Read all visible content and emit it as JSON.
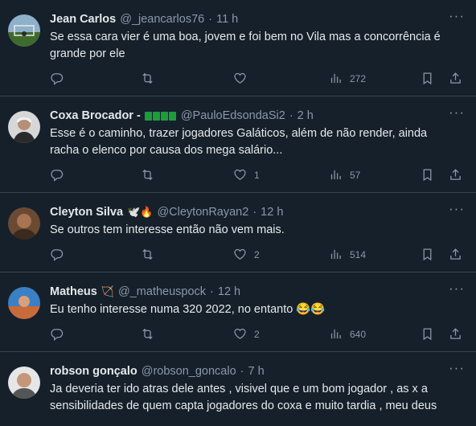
{
  "tweets": [
    {
      "name": "Jean Carlos",
      "handle": "@_jeancarlos76",
      "time": "11 h",
      "text": "Se essa cara vier é uma boa, jovem e foi bem no Vila mas a concorrência é grande por ele",
      "replies": "",
      "retweets": "",
      "likes": "",
      "views": "272"
    },
    {
      "name": "Coxa Brocador -",
      "handle": "@PauloEdsondaSi2",
      "time": "2 h",
      "text": "Esse é o caminho, trazer jogadores Galáticos, além de não render, ainda racha o elenco por causa dos mega salário...",
      "replies": "",
      "retweets": "",
      "likes": "1",
      "views": "57"
    },
    {
      "name": "Cleyton Silva",
      "name_emoji": "🕊️🔥",
      "handle": "@CleytonRayan2",
      "time": "12 h",
      "text": "Se outros tem interesse então não vem mais.",
      "replies": "",
      "retweets": "",
      "likes": "2",
      "views": "514"
    },
    {
      "name": "Matheus",
      "name_emoji": "🏹",
      "handle": "@_matheuspock",
      "time": "12 h",
      "text": "Eu tenho interesse numa 320 2022, no entanto 😂😂",
      "replies": "",
      "retweets": "",
      "likes": "2",
      "views": "640"
    },
    {
      "name": "robson gonçalo",
      "handle": "@robson_goncalo",
      "time": "7 h",
      "text": "Ja deveria ter ido atras dele antes ,  visivel que e um bom jogador , as x a sensibilidades de quem capta jogadores do coxa e muito tardia , meu deus"
    }
  ],
  "separator": "·",
  "more_label": "···",
  "colors": {
    "background": "#15202b",
    "muted": "#8b98a5",
    "text": "#e7e9ea",
    "divider": "#38444d",
    "flag_green": "#1f9a3c"
  }
}
